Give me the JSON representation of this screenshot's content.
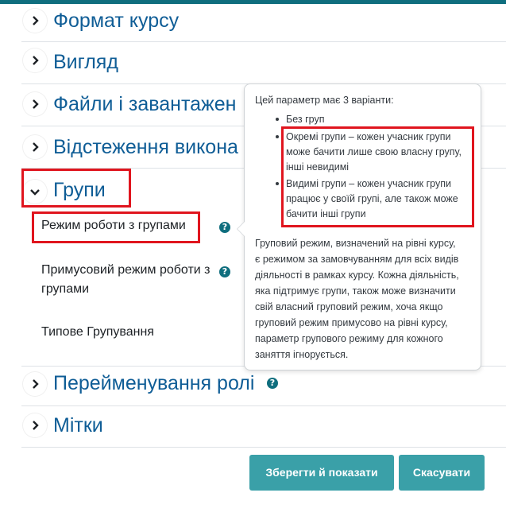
{
  "sections": {
    "course_format": "Формат курсу",
    "appearance": "Вигляд",
    "files": "Файли і завантажен",
    "completion": "Відстеження викона",
    "groups": "Групи",
    "role_renaming": "Перейменування ролі",
    "tags": "Мітки"
  },
  "groups_fields": {
    "group_mode": "Режим роботи з групами",
    "force_line1": "Примусовий режим роботи з",
    "force_line2": "групами",
    "default_grouping": "Типове Групування"
  },
  "help_glyph": "?",
  "popover": {
    "intro": "Цей параметр має 3 варіанти:",
    "option1": "Без груп",
    "option2_lines": [
      "Окремі групи – кожен учасник групи",
      "може бачити лише свою власну групу,",
      "інші невидимі"
    ],
    "option3_lines": [
      "Видимі групи – кожен учасник групи",
      "працює у своїй групі, але також може",
      "бачити інші групи"
    ],
    "body_lines": [
      "Груповий режим, визначений на рівні курсу,",
      "є режимом за замовчуванням для всіх видів",
      "діяльності в рамках курсу. Кожна діяльність,",
      "яка підтримує групи, також може визначити",
      "свій власний груповий режим, хоча якщо",
      "груповий режим примусово на рівні курсу,",
      "параметр групового режиму для кожного",
      "заняття ігнорується."
    ]
  },
  "buttons": {
    "save": "Зберегти й показати",
    "cancel": "Скасувати"
  },
  "colors": {
    "accent": "#0f6e7e",
    "link": "#0f5d96",
    "highlight": "#e0151e",
    "button": "#3aa0a8"
  }
}
